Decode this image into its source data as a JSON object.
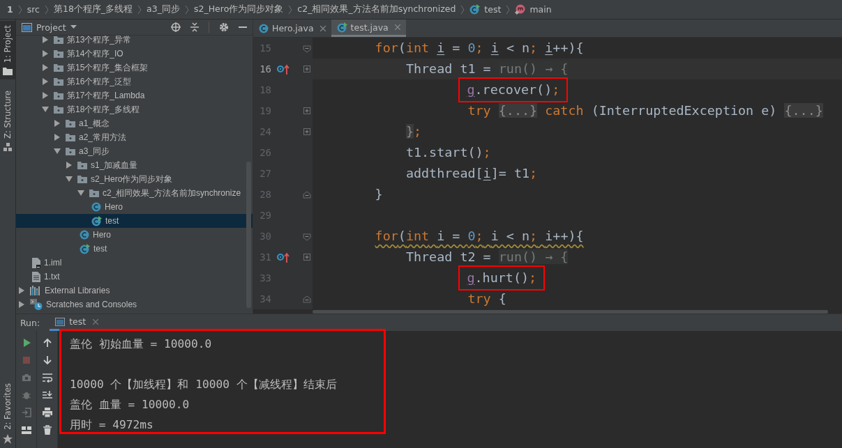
{
  "breadcrumb": [
    {
      "label": "1",
      "kind": "number"
    },
    {
      "label": "src",
      "kind": "plain"
    },
    {
      "label": "第18个程序_多线程",
      "kind": "plain"
    },
    {
      "label": "a3_同步",
      "kind": "plain"
    },
    {
      "label": "s2_Hero作为同步对象",
      "kind": "plain"
    },
    {
      "label": "c2_相同效果_方法名前加synchronized",
      "kind": "plain"
    },
    {
      "label": "test",
      "kind": "runclass"
    },
    {
      "label": "main",
      "kind": "method"
    }
  ],
  "tool_window_tabs": [
    {
      "label": "1: Project",
      "kind": "project",
      "selected": true
    },
    {
      "label": "Z: Structure",
      "kind": "structure",
      "selected": false
    }
  ],
  "bottom_tool_tabs": [
    {
      "label": "2: Favorites",
      "kind": "favorites",
      "selected": false
    }
  ],
  "project_panel": {
    "title": "Project",
    "tree": [
      {
        "children": [
          {
            "children": [
              {
                "label": "第13个程序_异常",
                "kind": "folder",
                "expanded": false,
                "selected": false
              },
              {
                "label": "第14个程序_IO",
                "kind": "folder",
                "expanded": false,
                "selected": false
              },
              {
                "label": "第15个程序_集合框架",
                "kind": "folder",
                "expanded": false,
                "selected": false
              },
              {
                "label": "第16个程序_泛型",
                "kind": "folder",
                "expanded": false,
                "selected": false
              },
              {
                "label": "第17个程序_Lambda",
                "kind": "folder",
                "expanded": false,
                "selected": false
              },
              {
                "label": "第18个程序_多线程",
                "kind": "folder",
                "expanded": true,
                "selected": false,
                "children": [
                  {
                    "label": "a1_概念",
                    "kind": "folder",
                    "expanded": false,
                    "selected": false
                  },
                  {
                    "label": "a2_常用方法",
                    "kind": "folder",
                    "expanded": false,
                    "selected": false
                  },
                  {
                    "label": "a3_同步",
                    "kind": "folder",
                    "expanded": true,
                    "selected": false,
                    "children": [
                      {
                        "label": "s1_加减血量",
                        "kind": "folder",
                        "expanded": false,
                        "selected": false
                      },
                      {
                        "label": "s2_Hero作为同步对象",
                        "kind": "folder",
                        "expanded": true,
                        "selected": false,
                        "children": [
                          {
                            "label": "c2_相同效果_方法名前加synchronize",
                            "kind": "folder",
                            "expanded": true,
                            "selected": false,
                            "children": [
                              {
                                "label": "Hero",
                                "kind": "class",
                                "selected": false
                              },
                              {
                                "label": "test",
                                "kind": "runclass",
                                "selected": true
                              }
                            ]
                          },
                          {
                            "label": "Hero",
                            "kind": "class",
                            "selected": false
                          },
                          {
                            "label": "test",
                            "kind": "runclass",
                            "selected": false
                          }
                        ]
                      }
                    ]
                  }
                ]
              }
            ]
          },
          {
            "label": "1.iml",
            "kind": "iml",
            "selected": false
          },
          {
            "label": "1.txt",
            "kind": "txt",
            "selected": false
          }
        ]
      },
      {
        "label": "External Libraries",
        "kind": "libraries",
        "expanded": false,
        "selected": false
      },
      {
        "label": "Scratches and Consoles",
        "kind": "scratches",
        "expanded": false,
        "selected": false
      }
    ]
  },
  "editor_tabs": [
    {
      "label": "Hero.java",
      "kind": "class",
      "selected": false
    },
    {
      "label": "test.java",
      "kind": "runclass",
      "selected": true
    }
  ],
  "code_lines": [
    {
      "number": "15",
      "kind": "fold-open",
      "current": false,
      "marker": false,
      "boxed": false,
      "warning": false,
      "tokens": [
        {
          "kind": "kw",
          "text": "        for"
        },
        {
          "kind": "plain",
          "text": "("
        },
        {
          "kind": "kw",
          "text": "int"
        },
        {
          "kind": "var",
          "text": " i"
        },
        {
          "kind": "plain",
          "text": " = "
        },
        {
          "kind": "num",
          "text": "0"
        },
        {
          "kind": "kw",
          "text": ";"
        },
        {
          "kind": "var",
          "text": " i"
        },
        {
          "kind": "plain",
          "text": " < n"
        },
        {
          "kind": "kw",
          "text": ";"
        },
        {
          "kind": "var",
          "text": " i"
        },
        {
          "kind": "plain",
          "text": "++){"
        }
      ]
    },
    {
      "number": "16",
      "kind": "fold-collapsed",
      "current": true,
      "marker": true,
      "boxed": false,
      "warning": false,
      "tokens": [
        {
          "kind": "plain",
          "text": "            Thread t1 = "
        },
        {
          "kind": "dim",
          "text": "run() → {"
        }
      ]
    },
    {
      "number": "18",
      "kind": "plain",
      "current": false,
      "marker": false,
      "boxed": true,
      "warning": false,
      "tokens": [
        {
          "kind": "field",
          "text": "                    g"
        },
        {
          "kind": "plain",
          "text": ".recover()"
        },
        {
          "kind": "kw",
          "text": ";"
        }
      ]
    },
    {
      "number": "19",
      "kind": "fold-collapsed",
      "current": false,
      "marker": false,
      "boxed": false,
      "warning": false,
      "tokens": [
        {
          "kind": "kw",
          "text": "                    try"
        },
        {
          "kind": "folded",
          "text": " {...}"
        },
        {
          "kind": "kw",
          "text": " catch"
        },
        {
          "kind": "plain",
          "text": " (InterruptedException e)"
        },
        {
          "kind": "folded",
          "text": " {...}"
        }
      ]
    },
    {
      "number": "24",
      "kind": "fold-collapsed",
      "current": false,
      "marker": false,
      "boxed": false,
      "warning": false,
      "tokens": [
        {
          "kind": "folded",
          "text": "            }"
        },
        {
          "kind": "kw",
          "text": ";"
        }
      ]
    },
    {
      "number": "26",
      "kind": "plain",
      "current": false,
      "marker": false,
      "boxed": false,
      "warning": false,
      "tokens": [
        {
          "kind": "plain",
          "text": "            t1.start()"
        },
        {
          "kind": "kw",
          "text": ";"
        }
      ]
    },
    {
      "number": "27",
      "kind": "plain",
      "current": false,
      "marker": false,
      "boxed": false,
      "warning": false,
      "tokens": [
        {
          "kind": "plain",
          "text": "            addthread["
        },
        {
          "kind": "var",
          "text": "i"
        },
        {
          "kind": "plain",
          "text": "]= t1"
        },
        {
          "kind": "kw",
          "text": ";"
        }
      ]
    },
    {
      "number": "28",
      "kind": "fold-close",
      "current": false,
      "marker": false,
      "boxed": false,
      "warning": false,
      "tokens": [
        {
          "kind": "plain",
          "text": "        }"
        }
      ]
    },
    {
      "number": "29",
      "kind": "plain",
      "current": false,
      "marker": false,
      "boxed": false,
      "warning": false
    },
    {
      "number": "30",
      "kind": "fold-open",
      "current": false,
      "marker": false,
      "boxed": false,
      "warning": true,
      "tokens": [
        {
          "kind": "kw",
          "text": "        for"
        },
        {
          "kind": "plain",
          "text": "("
        },
        {
          "kind": "kw",
          "text": "int"
        },
        {
          "kind": "plain",
          "text": " i = "
        },
        {
          "kind": "num",
          "text": "0"
        },
        {
          "kind": "kw",
          "text": ";"
        },
        {
          "kind": "plain",
          "text": " i < n"
        },
        {
          "kind": "kw",
          "text": ";"
        },
        {
          "kind": "plain",
          "text": " i++){"
        }
      ]
    },
    {
      "number": "31",
      "kind": "fold-collapsed",
      "current": false,
      "marker": true,
      "boxed": false,
      "warning": false,
      "tokens": [
        {
          "kind": "plain",
          "text": "            Thread t2 = "
        },
        {
          "kind": "dim",
          "text": "run() → {"
        }
      ]
    },
    {
      "number": "33",
      "kind": "plain",
      "current": false,
      "marker": false,
      "boxed": true,
      "warning": false,
      "tokens": [
        {
          "kind": "field",
          "text": "                    g"
        },
        {
          "kind": "plain",
          "text": ".hurt()"
        },
        {
          "kind": "kw",
          "text": ";"
        }
      ]
    },
    {
      "number": "34",
      "kind": "fold-close",
      "current": false,
      "marker": false,
      "boxed": false,
      "warning": false,
      "tokens": [
        {
          "kind": "kw",
          "text": "                    try"
        },
        {
          "kind": "plain",
          "text": " {"
        }
      ]
    }
  ],
  "run_panel": {
    "label": "Run:",
    "tabs": [
      {
        "label": "test",
        "selected": true
      }
    ],
    "toolbar_left": [
      {
        "kind": "run",
        "disabled": false
      },
      {
        "kind": "stop",
        "disabled": true
      },
      {
        "kind": "camera",
        "disabled": true
      },
      {
        "kind": "debug",
        "disabled": true
      },
      {
        "kind": "exit",
        "disabled": true
      },
      {
        "kind": "layout",
        "disabled": false
      }
    ],
    "toolbar_right": [
      {
        "kind": "up",
        "disabled": false
      },
      {
        "kind": "down",
        "disabled": false
      },
      {
        "kind": "wrap",
        "disabled": false
      },
      {
        "kind": "scroll-end",
        "disabled": false
      },
      {
        "kind": "print",
        "disabled": false
      },
      {
        "kind": "trash",
        "disabled": false
      }
    ],
    "boxed": true,
    "output": [
      {
        "kind": "text",
        "text": "盖伦 初始血量 = 10000.0"
      },
      {
        "kind": "blank"
      },
      {
        "kind": "text",
        "text": "10000 个【加线程】和 10000 个【减线程】结束后"
      },
      {
        "kind": "text",
        "text": "盖伦 血量 = 10000.0"
      },
      {
        "kind": "text",
        "text": "用时 = 4972ms"
      }
    ]
  }
}
